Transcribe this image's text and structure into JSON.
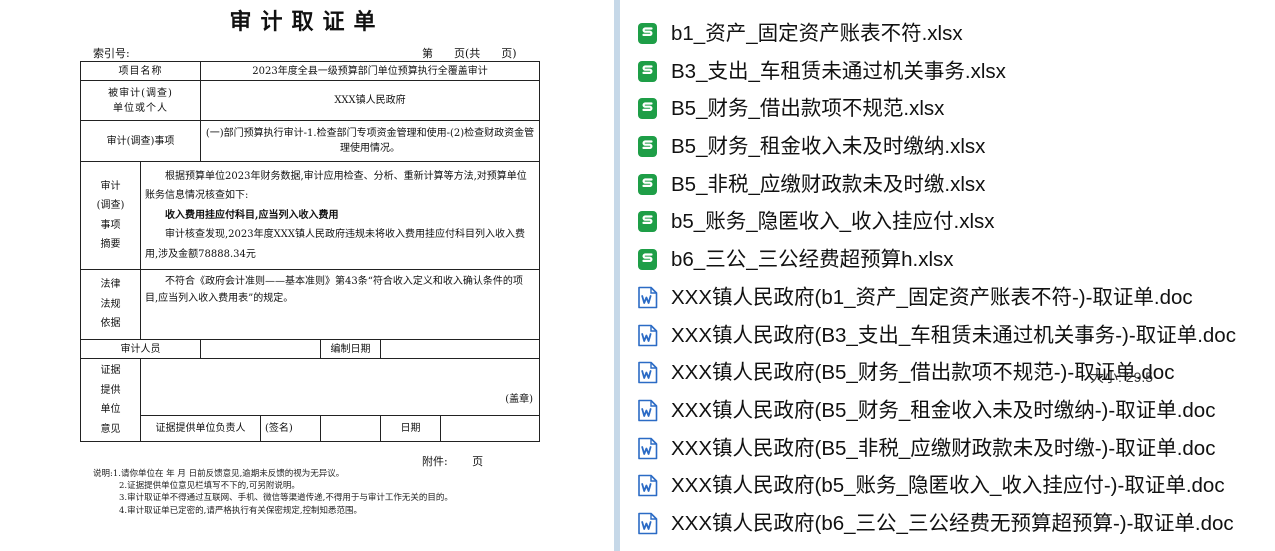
{
  "doc": {
    "title": "审计取证单",
    "index_label": "索引号:",
    "page_info": "第      页(共      页)",
    "rows": {
      "project_label": "项目名称",
      "project_value": "2023年度全县一级预算部门单位预算执行全覆盖审计",
      "audited_label_1": "被审计(调查)",
      "audited_label_2": "单位或个人",
      "audited_value": "XXX镇人民政府",
      "matter_label": "审计(调查)事项",
      "matter_value": "(一)部门预算执行审计-1.检查部门专项资金管理和使用-(2)检查财政资金管理使用情况。",
      "summary_label": [
        "审计",
        "(调查)",
        "事项",
        "摘要"
      ],
      "summary_p1": "根据预算单位2023年财务数据,审计应用检查、分析、重新计算等方法,对预算单位账务信息情况核查如下:",
      "summary_bold": "收入费用挂应付科目,应当列入收入费用",
      "summary_p2": "审计核查发现,2023年度XXX镇人民政府违规未将收入费用挂应付科目列入收入费用,涉及金额78888.34元",
      "law_label": [
        "法律",
        "法规",
        "依据"
      ],
      "law_value": "不符合《政府会计准则——基本准则》第43条“符合收入定义和收入确认条件的项目,应当列入收入费用表”的规定。",
      "auditor_label": "审计人员",
      "date_compile_label": "编制日期",
      "provider_label": [
        "证据",
        "提供",
        "单位",
        "意见"
      ],
      "stamp_label": "(盖章)",
      "provider_head_label": "证据提供单位负责人",
      "sign_label": "(签名)",
      "date_label": "日期"
    },
    "attachment": "附件:       页",
    "notes": [
      "说明:1.请你单位在      年   月    日前反馈意见,逾期未反馈的视为无异议。",
      "2.证据提供单位意见栏填写不下的,可另附说明。",
      "3.审计取证单不得通过互联网、手机、微信等渠道传递,不得用于与审计工作无关的目的。",
      "4.审计取证单已定密的,请严格执行有关保密规定,控制知悉范围。"
    ]
  },
  "files": [
    {
      "type": "sheet",
      "icon": "spreadsheet-icon",
      "name": "b1_资产_固定资产账表不符.xlsx"
    },
    {
      "type": "sheet",
      "icon": "spreadsheet-icon",
      "name": "B3_支出_车租赁未通过机关事务.xlsx"
    },
    {
      "type": "sheet",
      "icon": "spreadsheet-icon",
      "name": "B5_财务_借出款项不规范.xlsx"
    },
    {
      "type": "sheet",
      "icon": "spreadsheet-icon",
      "name": "B5_财务_租金收入未及时缴纳.xlsx"
    },
    {
      "type": "sheet",
      "icon": "spreadsheet-icon",
      "name": "B5_非税_应缴财政款未及时缴.xlsx"
    },
    {
      "type": "sheet",
      "icon": "spreadsheet-icon",
      "name": "b5_账务_隐匿收入_收入挂应付.xlsx"
    },
    {
      "type": "sheet",
      "icon": "spreadsheet-icon",
      "name": "b6_三公_三公经费超预算h.xlsx"
    },
    {
      "type": "word",
      "icon": "word-doc-icon",
      "name": "XXX镇人民政府(b1_资产_固定资产账表不符-)-取证单.doc"
    },
    {
      "type": "word",
      "icon": "word-doc-icon",
      "name": "XXX镇人民政府(B3_支出_车租赁未通过机关事务-)-取证单.doc"
    },
    {
      "type": "word",
      "icon": "word-doc-icon",
      "name": "XXX镇人民政府(B5_财务_借出款项不规范-)-取证单.doc"
    },
    {
      "type": "word",
      "icon": "word-doc-icon",
      "name": "XXX镇人民政府(B5_财务_租金收入未及时缴纳-)-取证单.doc"
    },
    {
      "type": "word",
      "icon": "word-doc-icon",
      "name": "XXX镇人民政府(B5_非税_应缴财政款未及时缴-)-取证单.doc"
    },
    {
      "type": "word",
      "icon": "word-doc-icon",
      "name": "XXX镇人民政府(b5_账务_隐匿收入_收入挂应付-)-取证单.doc"
    },
    {
      "type": "word",
      "icon": "word-doc-icon",
      "name": "XXX镇人民政府(b6_三公_三公经费无预算超预算-)-取证单.doc"
    }
  ],
  "overlay_text": "大小: 29.5",
  "colors": {
    "sheet_icon": "#1e9e47",
    "word_icon": "#2b6bc5",
    "divider": "#c6d8e8"
  }
}
